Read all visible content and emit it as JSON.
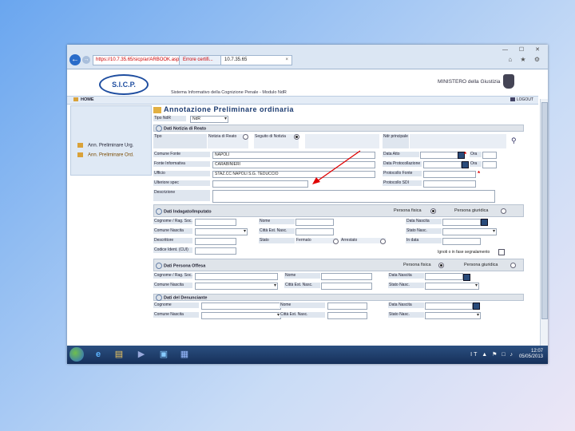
{
  "browser": {
    "url": "https://10.7.35.65/sicp/ar/ARBOOK.aspx",
    "cert_error": "Errore certifi...",
    "tab_title": "10.7.35.65",
    "tab_close": "×",
    "window_buttons": "— ☐ ✕",
    "toolbar_icons": "⌂ ★ ⚙"
  },
  "header": {
    "logo": "S.I.C.P.",
    "subtitle": "Sistema Informativo della Cognizione Penale - Modulo NdR",
    "ministry": "MINISTERO della Giustizia"
  },
  "navbar": {
    "home": "HOME",
    "logout": "LOGOUT"
  },
  "sidebar": {
    "items": [
      {
        "label": "Ann. Preliminare Urg."
      },
      {
        "label": "Ann. Preliminare Ord."
      }
    ]
  },
  "form": {
    "title": "Annotazione Preliminare ordinaria",
    "tipo_nr_label": "Tipo NdR",
    "tipo_nr_value": "NdR",
    "sections": {
      "notizia": "Dati Notizia di Reato",
      "indagato": "Dati Indagato/Imputato",
      "offeso": "Dati Persona Offesa",
      "denunciante": "Dati del Denunciante"
    },
    "fields": {
      "tipo": "Tipo",
      "notizia_reato": "Notizia di Reato",
      "seguito_notizia": "Seguito di Notizia",
      "ndr_principale": "Ndr principale",
      "comune_fonte": "Comune Fonte",
      "comune_fonte_value": "NAPOLI",
      "data_atto": "Data Atto",
      "ora": "Ora",
      "fonte_informativa": "Fonte Informativa",
      "fonte_informativa_value": "CARABINIERI",
      "data_protocollazione": "Data Protocollazione",
      "ufficio": "Ufficio",
      "ufficio_value": "STAZ.CC NAPOLI S.G. TEDUCCIO",
      "protocollo_fonte": "Protocollo Fonte",
      "ulteriore_spec": "Ulteriore spec",
      "protocollo_sdi": "Protocollo SDI",
      "descrizione": "Descrizione"
    },
    "indagato": {
      "persona_fisica": "Persona fisica",
      "persona_giuridica": "Persona giuridica",
      "cognome": "Cognome / Rag. Soc.",
      "nome": "Nome",
      "data_nascita": "Data Nascita",
      "comune_nascita": "Comune Nascita",
      "citta_est": "Città Est. Nasc.",
      "stato_nasc": "Stato Nasc.",
      "descrittore": "Descrittore",
      "stato": "Stato",
      "fermato": "Fermato",
      "arrestato": "Arrestato",
      "in_data": "In data",
      "codice_ident": "Codice Ident. (CUI)",
      "sconosciuto": "Ignoti o in fase segnalamento"
    },
    "offeso": {
      "persona_fisica": "Persona fisica",
      "persona_giuridica": "Persona giuridica",
      "cognome": "Cognome / Rag. Soc.",
      "nome": "Nome",
      "data_nascita": "Data Nascita",
      "comune_nascita": "Comune Nascita",
      "citta_est": "Città Est. Nasc.",
      "stato_nasc": "Stato Nasc."
    },
    "denunciante": {
      "cognome": "Cognome",
      "nome": "Nome",
      "data_nascita": "Data Nascita",
      "comune_nascita": "Comune Nascita",
      "citta_est": "Città Est. Nasc.",
      "stato_nasc": "Stato Nasc."
    }
  },
  "taskbar": {
    "lang": "IT",
    "time": "12:07",
    "date": "05/05/2013"
  },
  "colors": {
    "accent": "#1f4ea0",
    "arrow": "#e00000",
    "required": "#dd0000"
  }
}
